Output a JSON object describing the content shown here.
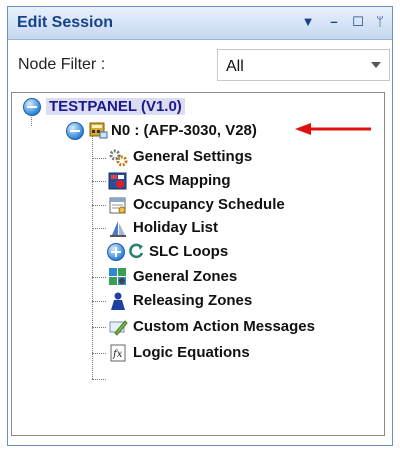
{
  "panel": {
    "title": "Edit Session",
    "controls": {
      "dropdown": "▼",
      "minimize": "–",
      "maximize": "☐",
      "pin": "ᛘ"
    }
  },
  "filter": {
    "label": "Node Filter :",
    "value": "All"
  },
  "tree": {
    "root": {
      "label": "TESTPANEL (V1.0)",
      "expanded": true
    },
    "panel_node": {
      "label": "N0 : (AFP-3030, V28)",
      "expanded": true
    },
    "items": [
      {
        "label": "General Settings",
        "icon": "gears-icon"
      },
      {
        "label": "ACS Mapping",
        "icon": "acs-mapping-icon"
      },
      {
        "label": "Occupancy Schedule",
        "icon": "calendar-icon"
      },
      {
        "label": "Holiday List",
        "icon": "holiday-list-icon"
      },
      {
        "label": "SLC Loops",
        "icon": "loop-refresh-icon",
        "expandable": true
      },
      {
        "label": "General Zones",
        "icon": "zones-grid-icon"
      },
      {
        "label": "Releasing Zones",
        "icon": "releasing-person-icon"
      },
      {
        "label": "Custom Action Messages",
        "icon": "message-pencil-icon"
      },
      {
        "label": "Logic Equations",
        "icon": "function-fx-icon"
      }
    ]
  },
  "annotation": {
    "arrow_color": "#e01010"
  }
}
